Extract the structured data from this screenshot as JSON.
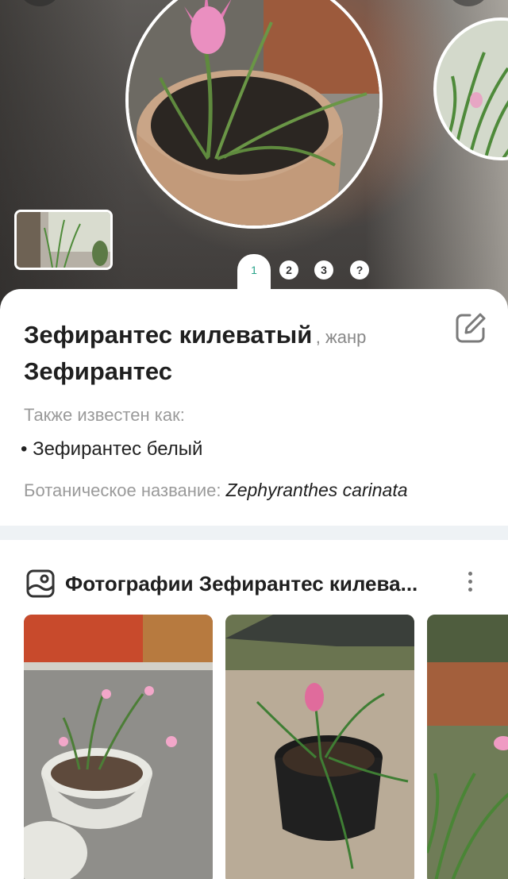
{
  "gallery": {
    "active_page": "1",
    "pages": [
      "2",
      "3",
      "?"
    ]
  },
  "plant": {
    "common_name": "Зефирантес килеватый",
    "genus_label": ", жанр",
    "genus": "Зефирантес",
    "aka_label": "Также известен как:",
    "aka_items": [
      "Зефирантес белый"
    ],
    "botanical_label": "Ботаническое название:",
    "botanical_name": "Zephyranthes carinata"
  },
  "photos_section": {
    "title": "Фотографии Зефирантес килева..."
  },
  "colors": {
    "accent": "#27a38a",
    "text": "#1f1f1f",
    "muted": "#9a9a9a"
  }
}
